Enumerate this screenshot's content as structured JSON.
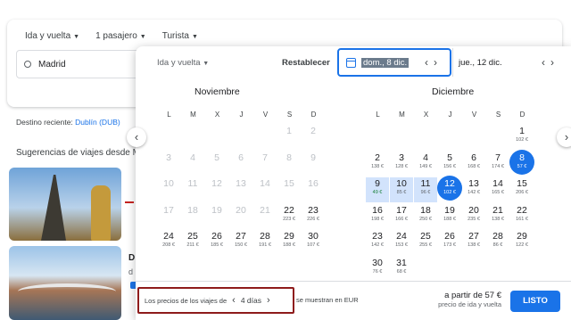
{
  "search": {
    "trip_type": "Ida y vuelta",
    "passengers": "1 pasajero",
    "cabin": "Turista",
    "origin": "Madrid"
  },
  "recent": {
    "label": "Destino reciente:",
    "link": "Dublín (DUB)"
  },
  "suggestions_title": "Sugerencias de viajes desde M",
  "side_card": {
    "title": "D",
    "sub": "d"
  },
  "picker": {
    "trip_type": "Ida y vuelta",
    "reset": "Restablecer",
    "depart": "dom., 8 dic.",
    "return": "jue., 12 dic.",
    "nav_prev": "‹",
    "nav_next": "›",
    "months": [
      "Noviembre",
      "Diciembre"
    ],
    "weekdays": [
      "L",
      "M",
      "X",
      "J",
      "V",
      "S",
      "D"
    ],
    "nov_days": [
      {
        "d": "1",
        "dis": true
      },
      {
        "d": "2",
        "dis": true
      },
      {
        "d": "3",
        "dis": true
      },
      {
        "d": "4",
        "dis": true
      },
      {
        "d": "5",
        "dis": true
      },
      {
        "d": "6",
        "dis": true
      },
      {
        "d": "7",
        "dis": true
      },
      {
        "d": "8",
        "dis": true
      },
      {
        "d": "9",
        "dis": true
      },
      {
        "d": "10",
        "dis": true
      },
      {
        "d": "11",
        "dis": true
      },
      {
        "d": "12",
        "dis": true
      },
      {
        "d": "13",
        "dis": true
      },
      {
        "d": "14",
        "dis": true
      },
      {
        "d": "15",
        "dis": true
      },
      {
        "d": "16",
        "dis": true
      },
      {
        "d": "17",
        "dis": true
      },
      {
        "d": "18",
        "dis": true
      },
      {
        "d": "19",
        "dis": true
      },
      {
        "d": "20",
        "dis": true
      },
      {
        "d": "21",
        "dis": true
      },
      {
        "d": "22",
        "p": "223 €"
      },
      {
        "d": "23",
        "p": "226 €"
      },
      {
        "d": "24",
        "p": "208 €"
      },
      {
        "d": "25",
        "p": "211 €"
      },
      {
        "d": "26",
        "p": "185 €"
      },
      {
        "d": "27",
        "p": "150 €"
      },
      {
        "d": "28",
        "p": "191 €"
      },
      {
        "d": "29",
        "p": "188 €"
      },
      {
        "d": "30",
        "p": "107 €"
      }
    ],
    "dec_days": [
      {
        "d": "1",
        "p": "102 €"
      },
      {
        "d": "2",
        "p": "138 €"
      },
      {
        "d": "3",
        "p": "128 €"
      },
      {
        "d": "4",
        "p": "149 €"
      },
      {
        "d": "5",
        "p": "156 €"
      },
      {
        "d": "6",
        "p": "168 €"
      },
      {
        "d": "7",
        "p": "174 €"
      },
      {
        "d": "8",
        "p": "57 €",
        "sel": true
      },
      {
        "d": "9",
        "p": "49 €",
        "cheap": true,
        "range": true
      },
      {
        "d": "10",
        "p": "85 €",
        "range": true
      },
      {
        "d": "11",
        "p": "96 €",
        "range": true
      },
      {
        "d": "12",
        "p": "102 €",
        "sel": true
      },
      {
        "d": "13",
        "p": "142 €"
      },
      {
        "d": "14",
        "p": "165 €"
      },
      {
        "d": "15",
        "p": "206 €"
      },
      {
        "d": "16",
        "p": "198 €"
      },
      {
        "d": "17",
        "p": "166 €"
      },
      {
        "d": "18",
        "p": "250 €"
      },
      {
        "d": "19",
        "p": "188 €"
      },
      {
        "d": "20",
        "p": "235 €"
      },
      {
        "d": "21",
        "p": "138 €"
      },
      {
        "d": "22",
        "p": "161 €"
      },
      {
        "d": "23",
        "p": "142 €"
      },
      {
        "d": "24",
        "p": "153 €"
      },
      {
        "d": "25",
        "p": "255 €"
      },
      {
        "d": "26",
        "p": "173 €"
      },
      {
        "d": "27",
        "p": "138 €"
      },
      {
        "d": "28",
        "p": "86 €"
      },
      {
        "d": "29",
        "p": "122 €"
      },
      {
        "d": "30",
        "p": "76 €"
      },
      {
        "d": "31",
        "p": "68 €"
      }
    ],
    "duration_prefix": "Los precios de los viajes de",
    "duration_value": "4 días",
    "currency_note": "se muestran en EUR",
    "from_price": "a partir de 57 €",
    "from_sub": "precio de ida y vuelta",
    "done": "LISTO"
  },
  "colors": {
    "accent": "#1a73e8",
    "range": "#d2e3fc",
    "cheap": "#188038",
    "highlight_box": "#8e1b1b"
  }
}
